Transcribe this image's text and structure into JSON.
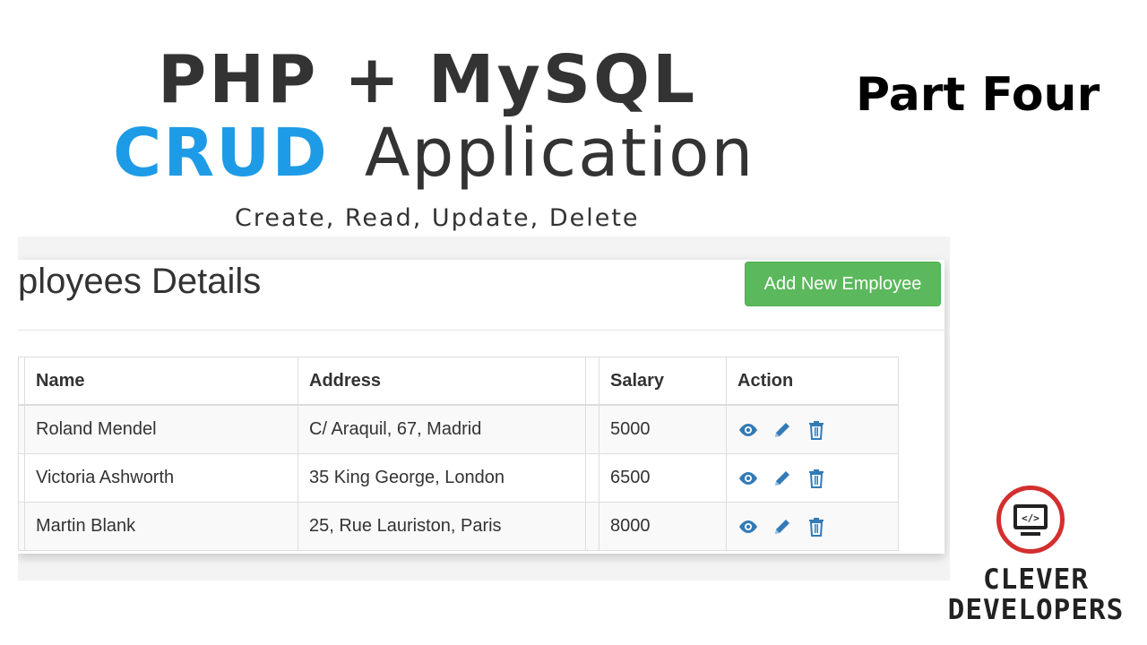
{
  "banner": {
    "line1": "PHP + MySQL",
    "line2_accent": "CRUD",
    "line2_rest": "Application",
    "subtitle": "Create, Read, Update, Delete",
    "part": "Part Four",
    "accent_color": "#1e9be6"
  },
  "app": {
    "heading": "Employees Details",
    "add_button_label": "Add New Employee",
    "add_button_color": "#5cb85c",
    "table": {
      "columns": [
        "Name",
        "Address",
        "Salary",
        "Action"
      ],
      "rows": [
        {
          "name": "Roland Mendel",
          "address": "C/ Araquil, 67, Madrid",
          "salary": "5000"
        },
        {
          "name": "Victoria Ashworth",
          "address": "35 King George, London",
          "salary": "6500"
        },
        {
          "name": "Martin Blank",
          "address": "25, Rue Lauriston, Paris",
          "salary": "8000"
        }
      ],
      "action_icons": [
        "eye-icon",
        "pencil-icon",
        "trash-icon"
      ],
      "icon_color": "#337ab7"
    }
  },
  "logo": {
    "line1": "CLEVER",
    "line2": "DEVELOPERS",
    "ring_color": "#d32f2f",
    "icon": "monitor-code-icon"
  }
}
